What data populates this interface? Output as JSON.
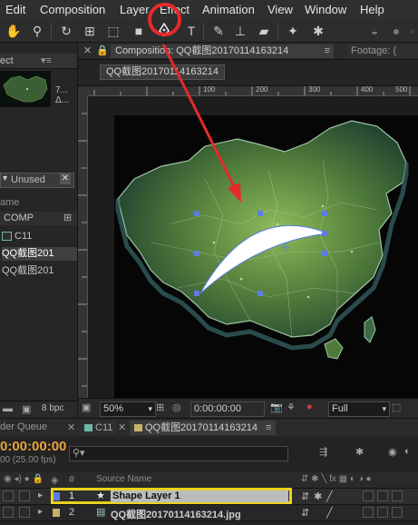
{
  "menu": {
    "items": [
      "Edit",
      "Composition",
      "Layer",
      "Effect",
      "Animation",
      "View",
      "Window",
      "Help"
    ]
  },
  "toolbar": {
    "highlighted_tool": "pen-tool"
  },
  "project_panel": {
    "tab_label": "ect",
    "thumb_text": [
      "7...",
      "Δ..."
    ],
    "filter_value": "Unused",
    "column_header": "ame",
    "items": [
      {
        "label": "COMP",
        "chip_color": "#c8c8c8"
      },
      {
        "label": "C11",
        "chip_color": "#6fb7a6"
      },
      {
        "label": "QQ截图201",
        "chip_color": "#c8c8c8"
      },
      {
        "label": "QQ截图201",
        "chip_color": "#c8c8c8"
      }
    ],
    "bpc": "8 bpc"
  },
  "comp_panel": {
    "tab_label": "Composition: QQ截图20170114163214",
    "tab_menu_icon": "≡",
    "footage_tab": "Footage: (",
    "breadcrumb": "QQ截图20170114163214",
    "ruler_marks": [
      "100",
      "200",
      "300",
      "400",
      "500"
    ],
    "zoom": "50%",
    "timecode": "0:00:00:00",
    "resolution": "Full"
  },
  "timeline": {
    "tabs": [
      "der Queue",
      "C11",
      "QQ截图20170114163214"
    ],
    "timecode": "0:00:00:00",
    "fps": "00 (25.00 fps)",
    "search_placeholder": "",
    "column_hash": "#",
    "column_source": "Source Name",
    "layers": [
      {
        "num": "1",
        "name": "Shape Layer 1",
        "type": "shape",
        "selected": true
      },
      {
        "num": "2",
        "name": "QQ截图20170114163214.jpg",
        "type": "footage",
        "selected": false
      }
    ]
  },
  "colors": {
    "annotation_red": "#e52a2a",
    "highlight_yellow": "#e8d21f",
    "accent_orange": "#e8a33a",
    "map_green": "#4f7a3a",
    "handle_blue": "#5c7ee0"
  }
}
